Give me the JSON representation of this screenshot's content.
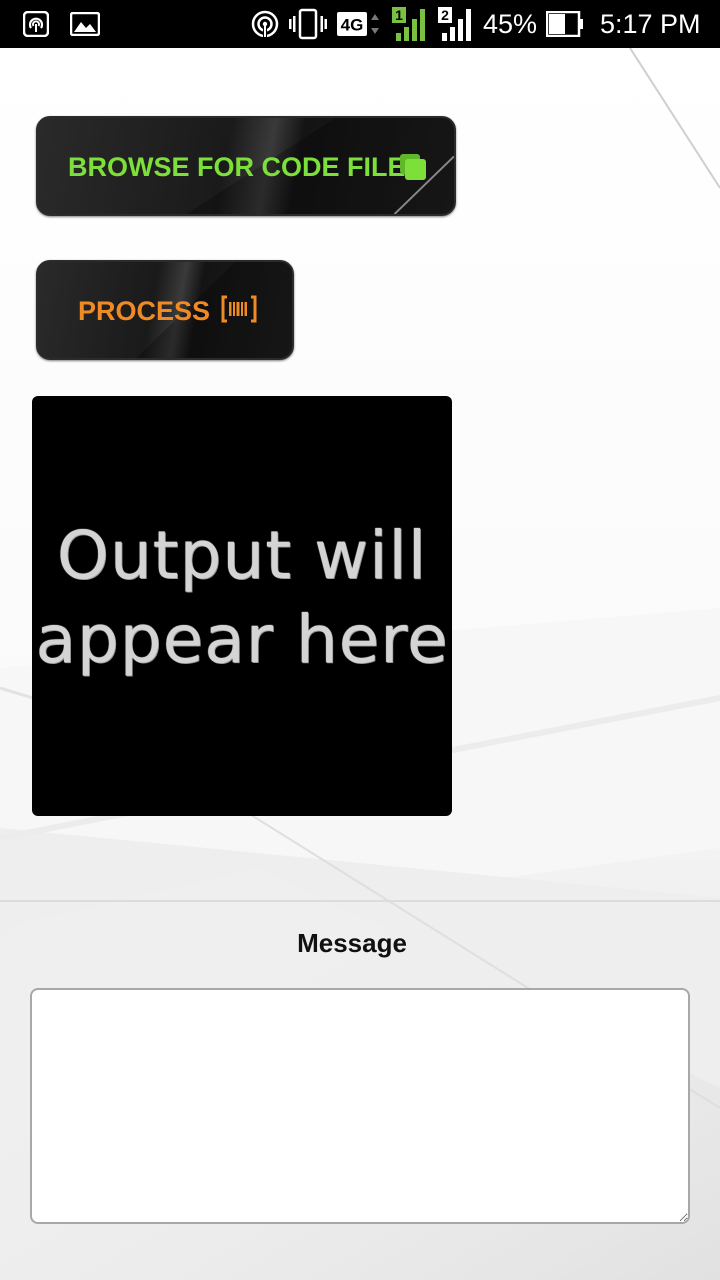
{
  "status_bar": {
    "battery_percent": "45%",
    "time": "5:17 PM",
    "network_type": "4G",
    "sim1_label": "1",
    "sim2_label": "2",
    "icons": [
      "hotspot-icon",
      "image-notification-icon",
      "wireless-icon",
      "vibrate-icon",
      "network-4g-icon",
      "signal-sim1-icon",
      "signal-sim2-icon",
      "battery-icon"
    ]
  },
  "buttons": {
    "browse_label": "BROWSE FOR CODE FILE",
    "browse_icon": "copy-icon",
    "browse_color": "#7de03a",
    "process_label": "PROCESS",
    "process_icon": "barcode-icon",
    "process_color": "#f08a24"
  },
  "output": {
    "line1": "Output will",
    "line2": "appear here"
  },
  "message": {
    "label": "Message",
    "value": ""
  }
}
